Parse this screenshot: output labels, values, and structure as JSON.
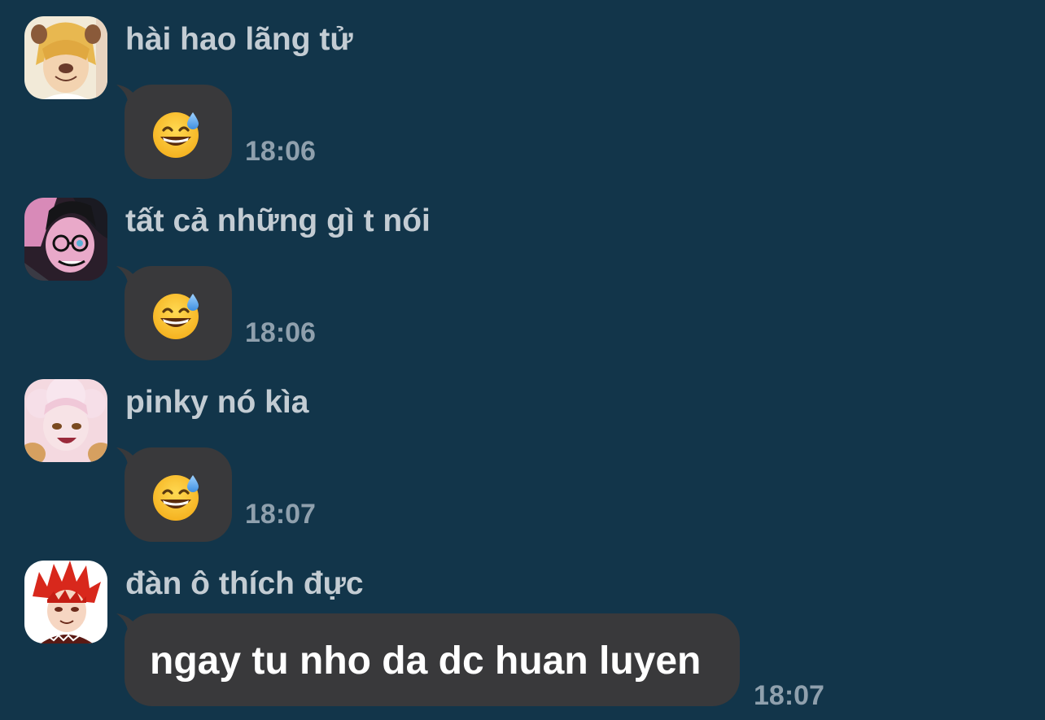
{
  "colors": {
    "background": "#12354a",
    "bubble": "#39393b",
    "sender_text": "#c3ccd3",
    "timestamp": "#8fa0ad",
    "message_text": "#ffffff"
  },
  "messages": [
    {
      "sender": "hài hao lãng tử",
      "avatar": "avatar-blonde-dog-filter",
      "content_type": "emoji",
      "emoji": "grinning-face-with-sweat-emoji",
      "time": "18:06"
    },
    {
      "sender": "tất cả những gì t nói",
      "avatar": "avatar-glasses-dark-hair",
      "content_type": "emoji",
      "emoji": "grinning-face-with-sweat-emoji",
      "time": "18:06"
    },
    {
      "sender": "pinky nó kìa",
      "avatar": "avatar-pink-hair",
      "content_type": "emoji",
      "emoji": "grinning-face-with-sweat-emoji",
      "time": "18:07"
    },
    {
      "sender": "đàn ô thích đực",
      "avatar": "avatar-red-spiky-hair",
      "content_type": "text",
      "text": "ngay tu nho da dc huan luyen",
      "time": "18:07"
    }
  ]
}
